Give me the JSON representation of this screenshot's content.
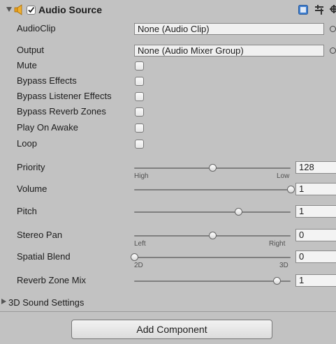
{
  "component": {
    "title": "Audio Source",
    "enabled": true,
    "expanded": true,
    "header_icons": [
      "help-icon",
      "preset-icon",
      "gear-icon"
    ]
  },
  "fields": {
    "audioclip": {
      "label": "AudioClip",
      "value": "None (Audio Clip)"
    },
    "output": {
      "label": "Output",
      "value": "None (Audio Mixer Group)"
    },
    "mute": {
      "label": "Mute",
      "checked": false
    },
    "bypass_effects": {
      "label": "Bypass Effects",
      "checked": false
    },
    "bypass_listener": {
      "label": "Bypass Listener Effects",
      "checked": false
    },
    "bypass_reverb": {
      "label": "Bypass Reverb Zones",
      "checked": false
    },
    "play_on_awake": {
      "label": "Play On Awake",
      "checked": false
    },
    "loop": {
      "label": "Loop",
      "checked": false
    }
  },
  "sliders": {
    "priority": {
      "label": "Priority",
      "value": "128",
      "min": 0,
      "max": 256,
      "left_hint": "High",
      "right_hint": "Low"
    },
    "volume": {
      "label": "Volume",
      "value": "1",
      "min": 0,
      "max": 1
    },
    "pitch": {
      "label": "Pitch",
      "value": "1",
      "min": -3,
      "max": 3
    },
    "stereo_pan": {
      "label": "Stereo Pan",
      "value": "0",
      "min": -1,
      "max": 1,
      "left_hint": "Left",
      "right_hint": "Right"
    },
    "spatial_blend": {
      "label": "Spatial Blend",
      "value": "0",
      "min": 0,
      "max": 1,
      "left_hint": "2D",
      "right_hint": "3D"
    },
    "reverb_zone_mix": {
      "label": "Reverb Zone Mix",
      "value": "1",
      "min": 0,
      "max": 1.1
    }
  },
  "sound_settings": {
    "label": "3D Sound Settings",
    "expanded": false
  },
  "add_component": {
    "label": "Add Component"
  }
}
